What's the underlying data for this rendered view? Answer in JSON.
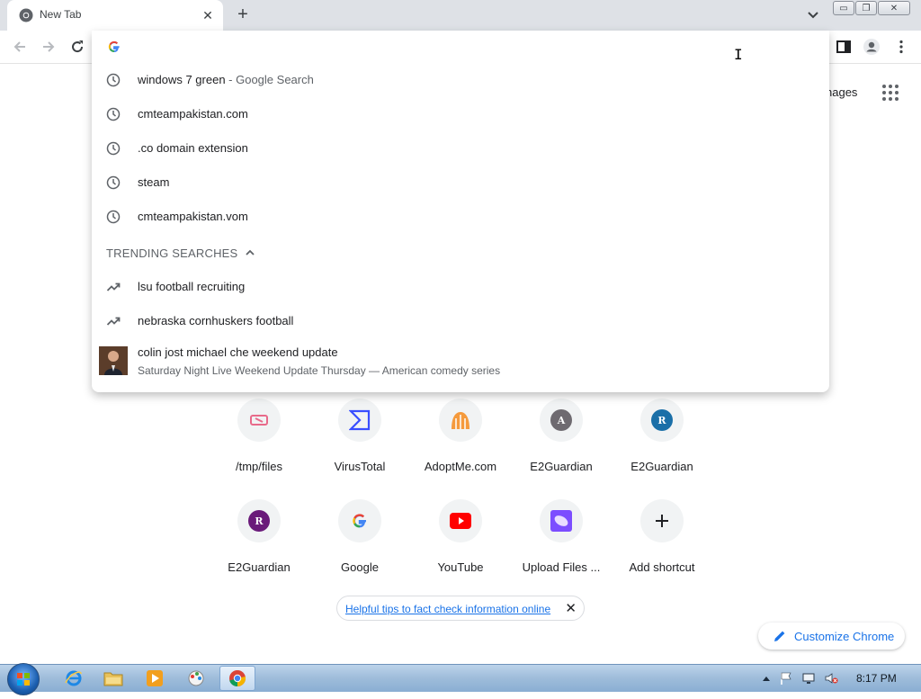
{
  "tab": {
    "title": "New Tab",
    "close_glyph": "✕",
    "favicon": "chrome-icon"
  },
  "new_tab_glyph": "+",
  "window_controls": {
    "minimize": "▭",
    "restore": "❐",
    "close": "✕"
  },
  "toolbar": {
    "back_icon": "arrow-left-icon",
    "forward_icon": "arrow-right-icon",
    "reload_icon": "reload-icon",
    "side_panel_icon": "side-panel-icon",
    "profile_icon": "profile-icon",
    "menu_icon": "kebab-menu-icon"
  },
  "omnibox": {
    "value": "",
    "search_engine_icon": "google-g-icon",
    "suggestions": [
      {
        "text": "windows 7 green",
        "suffix": " - Google Search",
        "icon": "history-clock-icon"
      },
      {
        "text": "cmteampakistan.com",
        "suffix": "",
        "icon": "history-clock-icon"
      },
      {
        "text": ".co domain extension",
        "suffix": "",
        "icon": "history-clock-icon"
      },
      {
        "text": "steam",
        "suffix": "",
        "icon": "history-clock-icon"
      },
      {
        "text": "cmteampakistan.vom",
        "suffix": "",
        "icon": "history-clock-icon"
      }
    ],
    "trending_header": "TRENDING SEARCHES",
    "trending": [
      {
        "text": "lsu football recruiting",
        "icon": "trending-up-icon"
      },
      {
        "text": "nebraska cornhuskers football",
        "icon": "trending-up-icon"
      }
    ],
    "rich_suggestion": {
      "title": "colin jost michael che weekend update",
      "description": "Saturday Night Live Weekend Update Thursday — American comedy series"
    }
  },
  "ntp": {
    "images_link": "nages",
    "shortcuts_row1": [
      {
        "label": "/tmp/files",
        "icon": "ticket-icon"
      },
      {
        "label": "VirusTotal",
        "icon": "virustotal-icon"
      },
      {
        "label": "AdoptMe.com",
        "icon": "adoptme-icon"
      },
      {
        "label": "E2Guardian",
        "letter": "A",
        "color": "#6e6a70"
      },
      {
        "label": "E2Guardian",
        "letter": "R",
        "color": "#1a6fa8"
      }
    ],
    "shortcuts_row2": [
      {
        "label": "E2Guardian",
        "letter": "R",
        "color": "#6a1a7a"
      },
      {
        "label": "Google",
        "icon": "google-g-icon"
      },
      {
        "label": "YouTube",
        "icon": "youtube-icon"
      },
      {
        "label": "Upload Files ...",
        "icon": "upload-files-icon"
      },
      {
        "label": "Add shortcut",
        "icon": "plus-icon"
      }
    ],
    "tip_text": "Helpful tips to fact check information online",
    "tip_close": "✕",
    "customize_label": "Customize Chrome"
  },
  "taskbar": {
    "clock": "8:17 PM",
    "apps": [
      "internet-explorer-icon",
      "file-explorer-icon",
      "media-player-icon",
      "paint-icon",
      "chrome-icon"
    ]
  },
  "colors": {
    "accent": "#1a73e8",
    "tab_strip": "#dee1e6",
    "youtube_red": "#ff0000"
  }
}
